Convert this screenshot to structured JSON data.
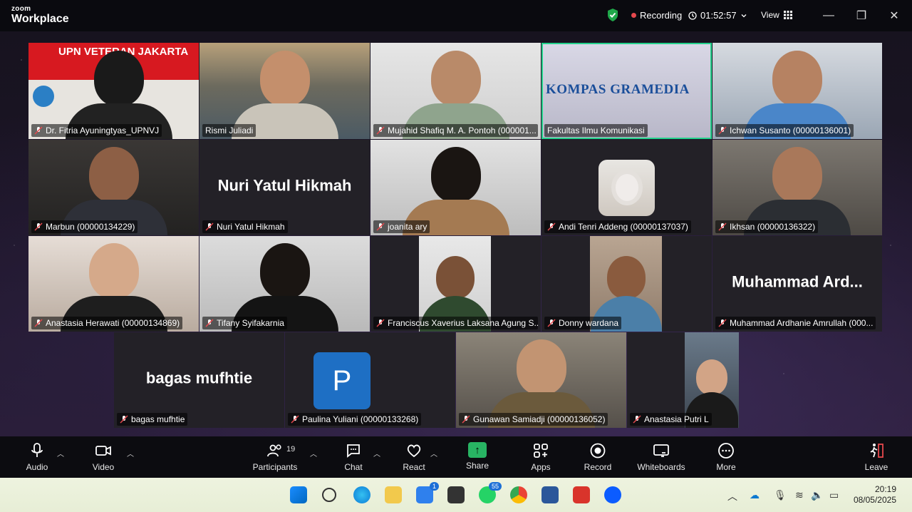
{
  "app": {
    "brand_top": "zoom",
    "brand_bottom": "Workplace"
  },
  "titlebar": {
    "recording": "Recording",
    "timer": "01:52:57",
    "view": "View",
    "minimize": "—",
    "maximize": "❐",
    "close": "✕"
  },
  "colors": {
    "active_speaker": "#23d18b",
    "recording_dot": "#e5484d",
    "share_green": "#28b463",
    "shield_green": "#1fa84a"
  },
  "tiles": [
    {
      "label": "Dr. Fitria Ayuningtyas_UPNVJ",
      "banner": "UPN VETERAN JAKARTA"
    },
    {
      "label": "Rismi Juliadi"
    },
    {
      "label": "Mujahid Shafiq M. A. Pontoh (000001..."
    },
    {
      "label": "Fakultas Ilmu Komunikasi",
      "logo_text": "KOMPAS GRAMEDIA"
    },
    {
      "label": "Ichwan Susanto (00000136001)"
    },
    {
      "label": "Marbun (00000134229)"
    },
    {
      "label": "Nuri Yatul Hikmah",
      "big": "Nuri Yatul Hikmah"
    },
    {
      "label": "joanita ary"
    },
    {
      "label": "Andi Tenri Addeng (00000137037)"
    },
    {
      "label": "Ikhsan (00000136322)"
    },
    {
      "label": "Anastasia Herawati (00000134869)"
    },
    {
      "label": "Tifany Syifakarnia"
    },
    {
      "label": "Franciscus Xaverius Laksana Agung S..."
    },
    {
      "label": "Donny wardana"
    },
    {
      "label": "Muhammad Ardhanie Amrullah (000...",
      "big": "Muhammad  Ard..."
    },
    {
      "label": "bagas mufhtie",
      "big": "bagas mufhtie"
    },
    {
      "label": "Paulina Yuliani (00000133268)",
      "avatar": "P"
    },
    {
      "label": "Gunawan Samiadji (00000136052)"
    },
    {
      "label": "Anastasia Putri L"
    }
  ],
  "toolbar": {
    "audio": "Audio",
    "video": "Video",
    "participants": "Participants",
    "participants_count": "19",
    "chat": "Chat",
    "react": "React",
    "share": "Share",
    "apps": "Apps",
    "record": "Record",
    "whiteboards": "Whiteboards",
    "more": "More",
    "leave": "Leave"
  },
  "taskbar": {
    "time": "20:19",
    "date": "08/05/2025",
    "todo_badge": "1",
    "whatsapp_badge": "55"
  }
}
